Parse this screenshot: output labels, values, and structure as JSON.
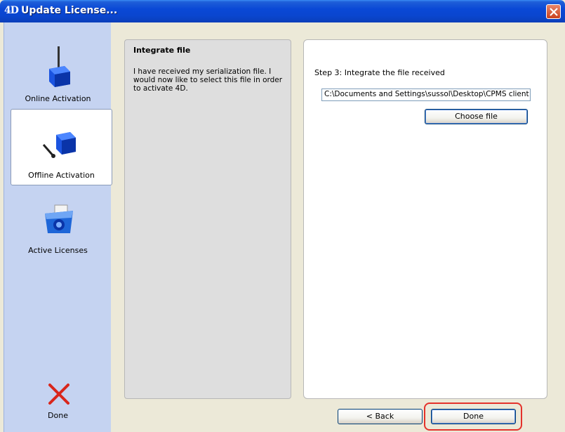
{
  "window": {
    "title": "Update License...",
    "logo": "4D"
  },
  "sidebar": {
    "items": [
      {
        "label": "Online Activation",
        "icon": "online-activation-icon"
      },
      {
        "label": "Offline Activation",
        "icon": "offline-activation-icon",
        "selected": true
      },
      {
        "label": "Active Licenses",
        "icon": "active-licenses-icon"
      },
      {
        "label": "Done",
        "icon": "close-x-icon"
      }
    ]
  },
  "description": {
    "title": "Integrate file",
    "text": "I have received my serialization file.  I would now like to select this file in order to activate 4D."
  },
  "content": {
    "step_label": "Step 3: Integrate the file received",
    "file_path": "C:\\Documents and Settings\\sussol\\Desktop\\CPMS client licens",
    "choose_button": "Choose file"
  },
  "footer": {
    "back_button": "< Back",
    "done_button": "Done"
  },
  "colors": {
    "titlebar": "#0A46CF",
    "sidebar": "#C5D3F1",
    "highlight": "#E4322B"
  }
}
